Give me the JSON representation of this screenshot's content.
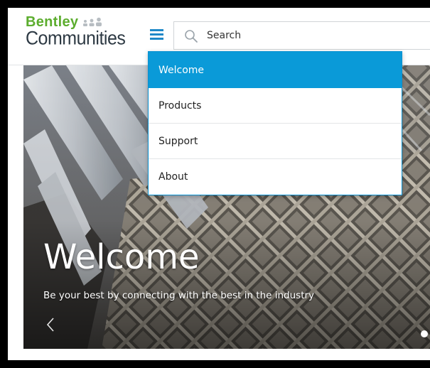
{
  "logo": {
    "line1": "Bentley",
    "line2": "Communities"
  },
  "search": {
    "placeholder": "Search"
  },
  "menu": {
    "items": [
      {
        "label": "Welcome",
        "active": true
      },
      {
        "label": "Products",
        "active": false
      },
      {
        "label": "Support",
        "active": false
      },
      {
        "label": "About",
        "active": false
      }
    ]
  },
  "hero": {
    "title": "Welcome",
    "subtitle": "Be your best by connecting with the best in the industry",
    "slide_index": 1
  },
  "colors": {
    "accent": "#0a9ad8",
    "brand_green": "#5cad2e",
    "menu_icon": "#1e88c8"
  }
}
